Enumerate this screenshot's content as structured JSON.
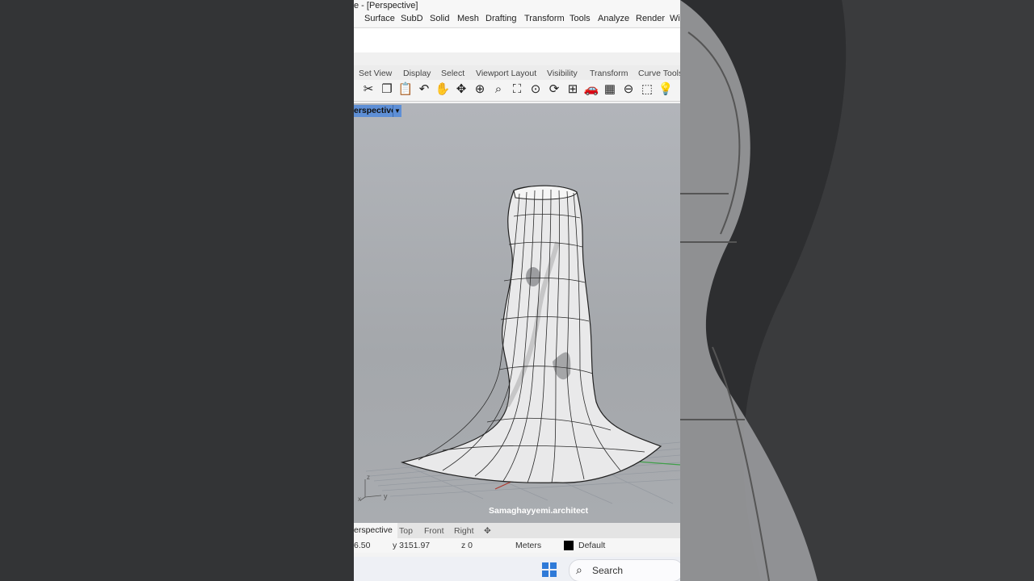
{
  "window": {
    "title": "e - [Perspective]"
  },
  "menu": [
    "Surface",
    "SubD",
    "Solid",
    "Mesh",
    "Drafting",
    "Transform",
    "Tools",
    "Analyze",
    "Render",
    "Wi"
  ],
  "toolbar_tabs": [
    "Set View",
    "Display",
    "Select",
    "Viewport Layout",
    "Visibility",
    "Transform",
    "Curve Tools"
  ],
  "tools": [
    {
      "name": "cut-icon",
      "glyph": "✂"
    },
    {
      "name": "copy-icon",
      "glyph": "❐"
    },
    {
      "name": "paste-icon",
      "glyph": "📋"
    },
    {
      "name": "undo-icon",
      "glyph": "↶"
    },
    {
      "name": "pan-hand-icon",
      "glyph": "✋"
    },
    {
      "name": "move-view-icon",
      "glyph": "✥"
    },
    {
      "name": "zoom-icon",
      "glyph": "⊕"
    },
    {
      "name": "zoom-window-icon",
      "glyph": "⌕"
    },
    {
      "name": "zoom-extents-icon",
      "glyph": "⛶"
    },
    {
      "name": "zoom-selected-icon",
      "glyph": "⊙"
    },
    {
      "name": "rotate-view-icon",
      "glyph": "⟳"
    },
    {
      "name": "four-viewports-icon",
      "glyph": "⊞"
    },
    {
      "name": "car-render-icon",
      "glyph": "🚗"
    },
    {
      "name": "grid-icon",
      "glyph": "▦"
    },
    {
      "name": "ortho-icon",
      "glyph": "⊖"
    },
    {
      "name": "select-icon",
      "glyph": "⬚"
    },
    {
      "name": "light-icon",
      "glyph": "💡"
    }
  ],
  "viewport": {
    "label": "erspective",
    "watermark": "Samaghayyemi.architect"
  },
  "viewport_tabs": [
    "erspective",
    "Top",
    "Front",
    "Right",
    "✥"
  ],
  "status": {
    "x": "6.50",
    "y": "y 3151.97",
    "z": "z 0",
    "units": "Meters",
    "layer": "Default"
  },
  "taskbar": {
    "search": "Search"
  }
}
